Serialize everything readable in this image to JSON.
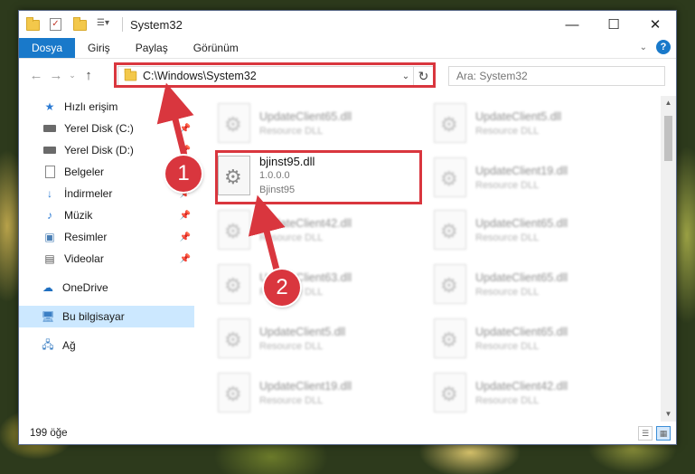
{
  "window": {
    "title": "System32",
    "controls": {
      "minimize": "—",
      "maximize": "☐",
      "close": "✕"
    }
  },
  "ribbon": {
    "tabs": [
      {
        "label": "Dosya",
        "active": true
      },
      {
        "label": "Giriş"
      },
      {
        "label": "Paylaş"
      },
      {
        "label": "Görünüm"
      }
    ],
    "help": "?"
  },
  "nav": {
    "address": "C:\\Windows\\System32",
    "search_placeholder": "Ara: System32"
  },
  "sidebar": {
    "items": [
      {
        "label": "Hızlı erişim",
        "icon": "star-icon"
      },
      {
        "label": "Yerel Disk (C:)",
        "icon": "drive-icon",
        "pinned": true
      },
      {
        "label": "Yerel Disk (D:)",
        "icon": "drive-icon",
        "pinned": true
      },
      {
        "label": "Belgeler",
        "icon": "documents-icon",
        "pinned": true
      },
      {
        "label": "İndirmeler",
        "icon": "downloads-icon",
        "pinned": true
      },
      {
        "label": "Müzik",
        "icon": "music-icon",
        "pinned": true
      },
      {
        "label": "Resimler",
        "icon": "pictures-icon",
        "pinned": true
      },
      {
        "label": "Videolar",
        "icon": "videos-icon",
        "pinned": true
      },
      {
        "label": "OneDrive",
        "icon": "cloud-icon"
      },
      {
        "label": "Bu bilgisayar",
        "icon": "computer-icon",
        "selected": true
      },
      {
        "label": "Ağ",
        "icon": "network-icon"
      }
    ]
  },
  "files": {
    "left_column": [
      {
        "name": "UpdateClient65.dll",
        "type": "Resource DLL"
      },
      {
        "name": "bjinst95.dll",
        "version": "1.0.0.0",
        "description": "Bjinst95",
        "highlighted": true
      },
      {
        "name": "UpdateClient42.dll",
        "type": "Resource DLL"
      },
      {
        "name": "UpdateClient63.dll",
        "type": "Resource DLL"
      },
      {
        "name": "UpdateClient5.dll",
        "type": "Resource DLL"
      },
      {
        "name": "UpdateClient19.dll",
        "type": "Resource DLL"
      }
    ],
    "right_column": [
      {
        "name": "UpdateClient5.dll",
        "type": "Resource DLL"
      },
      {
        "name": "UpdateClient19.dll",
        "type": "Resource DLL"
      },
      {
        "name": "UpdateClient65.dll",
        "type": "Resource DLL"
      },
      {
        "name": "UpdateClient65.dll",
        "type": "Resource DLL"
      },
      {
        "name": "UpdateClient65.dll",
        "type": "Resource DLL"
      },
      {
        "name": "UpdateClient42.dll",
        "type": "Resource DLL"
      }
    ]
  },
  "status": {
    "item_count": "199 öğe"
  },
  "annotations": {
    "badges": [
      "1",
      "2"
    ],
    "color": "#d9363e"
  }
}
